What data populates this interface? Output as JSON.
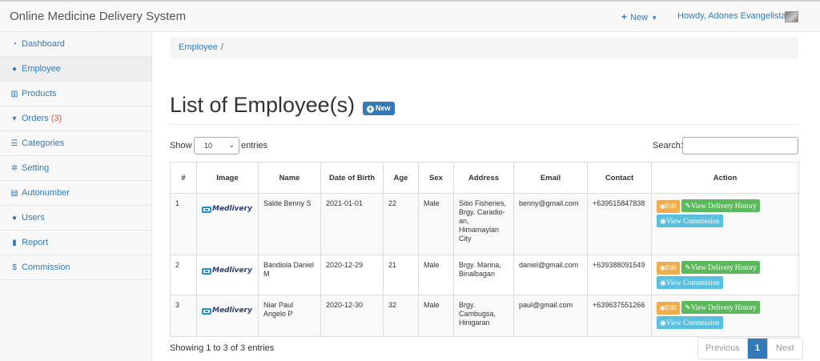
{
  "app": {
    "title": "Online Medicine Delivery System"
  },
  "navbar": {
    "new_label": "New",
    "howdy": "Howdy, Adones Evangelista"
  },
  "sidebar": {
    "items": [
      {
        "label": "Dashboard",
        "icon": "dashboard-icon"
      },
      {
        "label": "Employee",
        "icon": "users-icon"
      },
      {
        "label": "Products",
        "icon": "barcode-icon"
      },
      {
        "label": "Orders",
        "icon": "cart-icon",
        "badge": "(3)"
      },
      {
        "label": "Categories",
        "icon": "list-icon"
      },
      {
        "label": "Setting",
        "icon": "gears-icon"
      },
      {
        "label": "Autonumber",
        "icon": "list-alt-icon"
      },
      {
        "label": "Users",
        "icon": "user-icon"
      },
      {
        "label": "Report",
        "icon": "file-icon"
      },
      {
        "label": "Commission",
        "icon": "dollar-icon"
      }
    ]
  },
  "breadcrumb": {
    "link": "Employee",
    "sep": "/"
  },
  "page": {
    "title": "List of Employee(s)",
    "new_button": "New"
  },
  "table_controls": {
    "show": "Show",
    "entries_value": "10",
    "entries": "entries",
    "search": "Search:"
  },
  "table": {
    "headers": [
      "#",
      "Image",
      "Name",
      "Date of Birth",
      "Age",
      "Sex",
      "Address",
      "Email",
      "Contact",
      "Action"
    ],
    "logo_text_a": "Med",
    "logo_text_b": "livery",
    "actions": {
      "edit": "Edit",
      "history": "View Delivery History",
      "commission": "View Commission"
    },
    "rows": [
      {
        "no": "1",
        "name": "Salde Benny S",
        "dob": "2021-01-01",
        "age": "22",
        "sex": "Male",
        "address": "Sitio Fisheries, Brgy. Caradio-an, Himamaylan City",
        "email": "benny@gmail.com",
        "contact": "+639515847838"
      },
      {
        "no": "2",
        "name": "Bandiola Daniel M",
        "dob": "2020-12-29",
        "age": "21",
        "sex": "Male",
        "address": "Brgy. Marina, Binalbagan",
        "email": "daniel@gmail.com",
        "contact": "+639388091549"
      },
      {
        "no": "3",
        "name": "Niar Paul Angelo P",
        "dob": "2020-12-30",
        "age": "32",
        "sex": "Male",
        "address": "Brgy. Cambugsa, Hinigaran",
        "email": "paul@gmail.com",
        "contact": "+639637551266"
      }
    ]
  },
  "footer": {
    "info": "Showing 1 to 3 of 3 entries",
    "prev": "Previous",
    "page": "1",
    "next": "Next"
  },
  "colors": {
    "link": "#337ab7",
    "edit": "#f0ad4e",
    "history": "#5cb85c",
    "commission": "#5bc0de",
    "badge": "#d9534f"
  }
}
